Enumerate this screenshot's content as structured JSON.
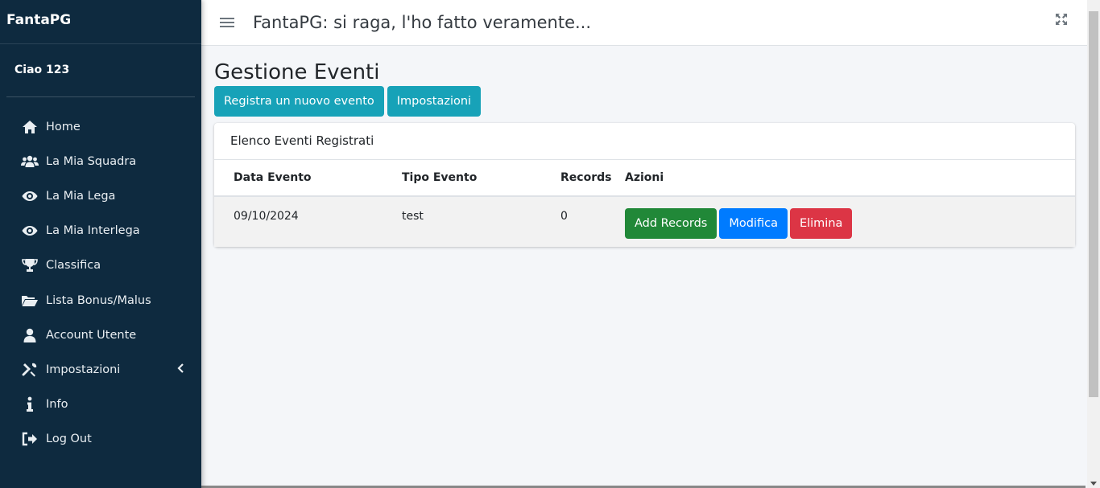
{
  "sidebar": {
    "brand": "FantaPG",
    "user": "Ciao 123",
    "items": [
      {
        "label": "Home",
        "icon": "home-icon"
      },
      {
        "label": "La Mia Squadra",
        "icon": "users-icon"
      },
      {
        "label": "La Mia Lega",
        "icon": "eye-icon"
      },
      {
        "label": "La Mia Interlega",
        "icon": "eye-icon"
      },
      {
        "label": "Classifica",
        "icon": "trophy-icon"
      },
      {
        "label": "Lista Bonus/Malus",
        "icon": "folder-open-icon"
      },
      {
        "label": "Account Utente",
        "icon": "user-icon"
      },
      {
        "label": "Impostazioni",
        "icon": "tools-icon"
      },
      {
        "label": "Info",
        "icon": "info-icon"
      },
      {
        "label": "Log Out",
        "icon": "sign-out-icon"
      }
    ]
  },
  "topbar": {
    "title": "FantaPG: si raga, l'ho fatto veramente..."
  },
  "main": {
    "page_title": "Gestione Eventi",
    "buttons": {
      "new_event": "Registra un nuovo evento",
      "settings": "Impostazioni"
    },
    "card": {
      "header": "Elenco Eventi Registrati",
      "columns": [
        "Data Evento",
        "Tipo Evento",
        "Records",
        "Azioni"
      ],
      "rows": [
        {
          "date": "09/10/2024",
          "type": "test",
          "records": "0"
        }
      ],
      "actions": {
        "add": "Add Records",
        "edit": "Modifica",
        "delete": "Elimina"
      }
    }
  },
  "colors": {
    "sidebar_bg": "#0e2a3f",
    "info": "#17a2b8",
    "success": "#218838",
    "primary": "#007bff",
    "danger": "#dc3545"
  }
}
